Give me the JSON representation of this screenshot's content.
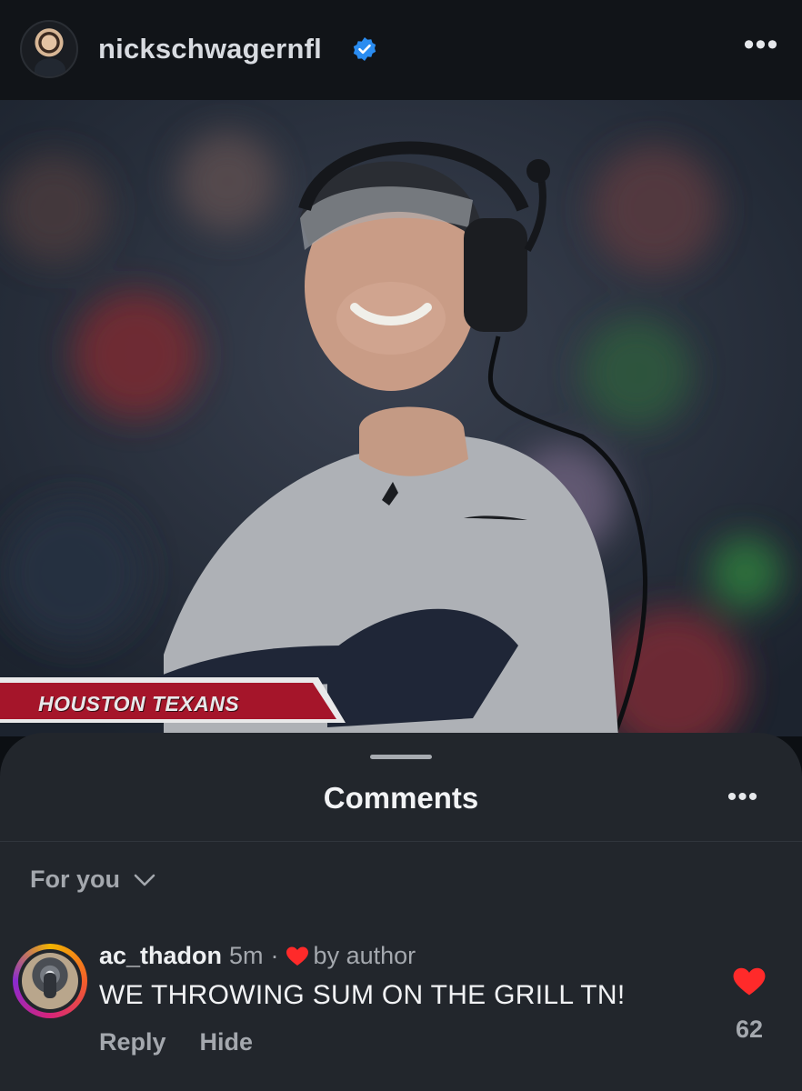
{
  "post_header": {
    "username": "nickschwagernfl",
    "verified_icon": "verified-badge-icon",
    "more_icon": "more-options-icon",
    "more_label": "•••",
    "accent_color": "#2a8cf0"
  },
  "photo": {
    "banner_text": "HOUSTON TEXANS",
    "banner_color": "#a5152a"
  },
  "comments_sheet": {
    "title": "Comments",
    "more_label": "•••",
    "filter_label": "For you",
    "filter_icon": "chevron-down-icon"
  },
  "comments": [
    {
      "username": "ac_thadon",
      "time": "5m",
      "separator": "·",
      "liked_by_author_label": "by author",
      "text": "WE THROWING SUM ON THE GRILL TN!",
      "reply_label": "Reply",
      "hide_label": "Hide",
      "like_count": "62",
      "heart_color": "#ff2a2a"
    }
  ]
}
